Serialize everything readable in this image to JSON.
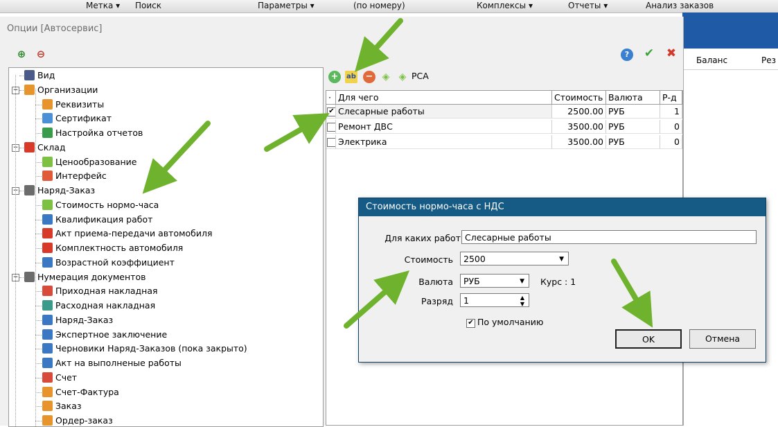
{
  "bg_toolbar": {
    "items": [
      "Метка ▾",
      "Поиск",
      "Параметры ▾",
      "(по номеру)",
      "Комплексы ▾",
      "Отчеты ▾",
      "Анализ заказов"
    ]
  },
  "bg_grid": {
    "col_balance": "Баланс",
    "col_rez": "Рез"
  },
  "window": {
    "title": "Опции [Автосервис]"
  },
  "tree": [
    {
      "label": "Вид",
      "level": 0,
      "expander": "",
      "icon": "grid-icon",
      "color": "#4a5b8a"
    },
    {
      "label": "Организации",
      "level": 0,
      "expander": "−",
      "icon": "house-icon",
      "color": "#e8942c"
    },
    {
      "label": "Реквизиты",
      "level": 1,
      "expander": "",
      "icon": "house-icon",
      "color": "#e8942c"
    },
    {
      "label": "Сертификат",
      "level": 1,
      "expander": "",
      "icon": "document-icon",
      "color": "#4b8fd6"
    },
    {
      "label": "Настройка отчетов",
      "level": 1,
      "expander": "",
      "icon": "report-icon",
      "color": "#3a9b4a"
    },
    {
      "label": "Склад",
      "level": 0,
      "expander": "−",
      "icon": "box-icon",
      "color": "#d83a2a"
    },
    {
      "label": "Ценообразование",
      "level": 1,
      "expander": "",
      "icon": "tag-icon",
      "color": "#7cc142"
    },
    {
      "label": "Интерфейс",
      "level": 1,
      "expander": "",
      "icon": "interface-icon",
      "color": "#e05a3a"
    },
    {
      "label": "Наряд-Заказ",
      "level": 0,
      "expander": "−",
      "icon": "documents-icon",
      "color": "#6b6b6b"
    },
    {
      "label": "Стоимость нормо-часа",
      "level": 1,
      "expander": "",
      "icon": "tag-icon",
      "color": "#7cc142"
    },
    {
      "label": "Квалификация работ",
      "level": 1,
      "expander": "",
      "icon": "wrench-icon",
      "color": "#3b78c4"
    },
    {
      "label": "Акт приема-передачи автомобиля",
      "level": 1,
      "expander": "",
      "icon": "car-icon",
      "color": "#d83a2a"
    },
    {
      "label": "Комплектность автомобиля",
      "level": 1,
      "expander": "",
      "icon": "car-icon",
      "color": "#d83a2a"
    },
    {
      "label": "Возрастной коэффициент",
      "level": 1,
      "expander": "",
      "icon": "wrench-icon",
      "color": "#3b78c4"
    },
    {
      "label": "Нумерация документов",
      "level": 0,
      "expander": "−",
      "icon": "documents-icon",
      "color": "#6b6b6b"
    },
    {
      "label": "Приходная накладная",
      "level": 1,
      "expander": "",
      "icon": "invoice-in-icon",
      "color": "#d84a3a"
    },
    {
      "label": "Расходная накладная",
      "level": 1,
      "expander": "",
      "icon": "invoice-out-icon",
      "color": "#3a9b8a"
    },
    {
      "label": "Наряд-Заказ",
      "level": 1,
      "expander": "",
      "icon": "wrench-icon",
      "color": "#3b78c4"
    },
    {
      "label": "Экспертное заключение",
      "level": 1,
      "expander": "",
      "icon": "wrench-icon",
      "color": "#3b78c4"
    },
    {
      "label": "Черновики Наряд-Заказов (пока закрыто)",
      "level": 1,
      "expander": "",
      "icon": "wrench-icon",
      "color": "#3b78c4"
    },
    {
      "label": "Акт на выполненые работы",
      "level": 1,
      "expander": "",
      "icon": "wrench-icon",
      "color": "#3b78c4"
    },
    {
      "label": "Счет",
      "level": 1,
      "expander": "",
      "icon": "question-doc-icon",
      "color": "#d84a3a"
    },
    {
      "label": "Счет-Фактура",
      "level": 1,
      "expander": "",
      "icon": "document-icon",
      "color": "#e8942c"
    },
    {
      "label": "Заказ",
      "level": 1,
      "expander": "",
      "icon": "order-icon",
      "color": "#e8942c"
    },
    {
      "label": "Ордер-заказ",
      "level": 1,
      "expander": "",
      "icon": "order-icon",
      "color": "#e8942c"
    }
  ],
  "right_toolbar": {
    "pca_label": "PCA"
  },
  "grid": {
    "headers": [
      "Для чего",
      "Стоимость",
      "Валюта",
      "Р-д"
    ],
    "rows": [
      {
        "checked": true,
        "name": "Слесарные работы",
        "cost": "2500.00",
        "currency": "РУБ",
        "grade": "1"
      },
      {
        "checked": false,
        "name": "Ремонт ДВС",
        "cost": "3500.00",
        "currency": "РУБ",
        "grade": "0"
      },
      {
        "checked": false,
        "name": "Электрика",
        "cost": "3500.00",
        "currency": "РУБ",
        "grade": "0"
      }
    ]
  },
  "dialog": {
    "title": "Стоимость нормо-часа с НДС",
    "work_label": "Для каких работ",
    "work_value": "Слесарные работы",
    "cost_label": "Стоимость",
    "cost_value": "2500",
    "currency_label": "Валюта",
    "currency_value": "РУБ",
    "rate_text": "Курс : 1",
    "grade_label": "Разряд",
    "grade_value": "1",
    "default_checked": true,
    "default_label": "По умолчанию",
    "ok_label": "OK",
    "cancel_label": "Отмена"
  },
  "colors": {
    "dialog_title_bg": "#165b85",
    "arrow": "#6fb22e",
    "accent_blue": "#1f5aa6"
  }
}
